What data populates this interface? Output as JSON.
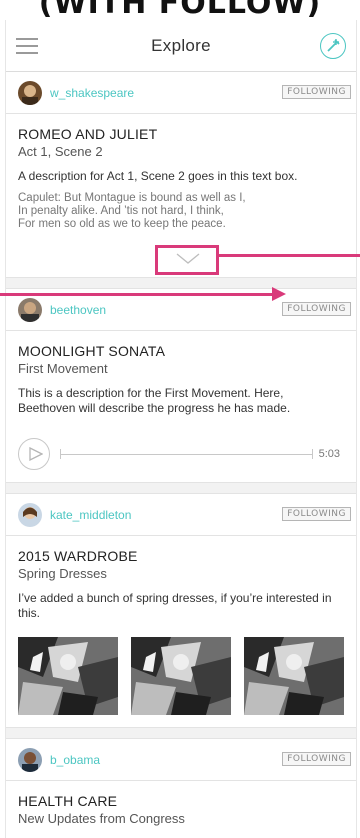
{
  "caption": "(WITH FOLLOW)",
  "header": {
    "title": "Explore",
    "menu_icon": "hamburger-menu-icon",
    "compose_icon": "compose-pencil-icon",
    "accent_color": "#4cc6c2"
  },
  "annotation_color": "#d93a7a",
  "posts": [
    {
      "username": "w_shakespeare",
      "follow_label": "FOLLOWING",
      "title": "ROMEO AND JULIET",
      "subtitle": "Act 1, Scene 2",
      "description": "A description for Act 1, Scene 2 goes in this text box.",
      "quote_lines": [
        "Capulet: But Montague is bound as well as I,",
        "In penalty alike. And ’tis not hard, I think,",
        "For men so old as we to keep the peace."
      ],
      "expand_icon": "chevron-down-icon"
    },
    {
      "username": "beethoven",
      "follow_label": "FOLLOWING",
      "title": "MOONLIGHT SONATA",
      "subtitle": "First Movement",
      "description": "This is a description for the First Movement. Here, Beethoven will describe the progress he has made.",
      "audio": {
        "duration": "5:03",
        "progress": 0,
        "play_icon": "play-icon"
      }
    },
    {
      "username": "kate_middleton",
      "follow_label": "FOLLOWING",
      "title": "2015 WARDROBE",
      "subtitle": "Spring Dresses",
      "description": "I’ve added a bunch of spring dresses, if you’re interested in this.",
      "image_count": 3
    },
    {
      "username": "b_obama",
      "follow_label": "FOLLOWING",
      "title": "HEALTH CARE",
      "subtitle": "New Updates from Congress"
    }
  ]
}
